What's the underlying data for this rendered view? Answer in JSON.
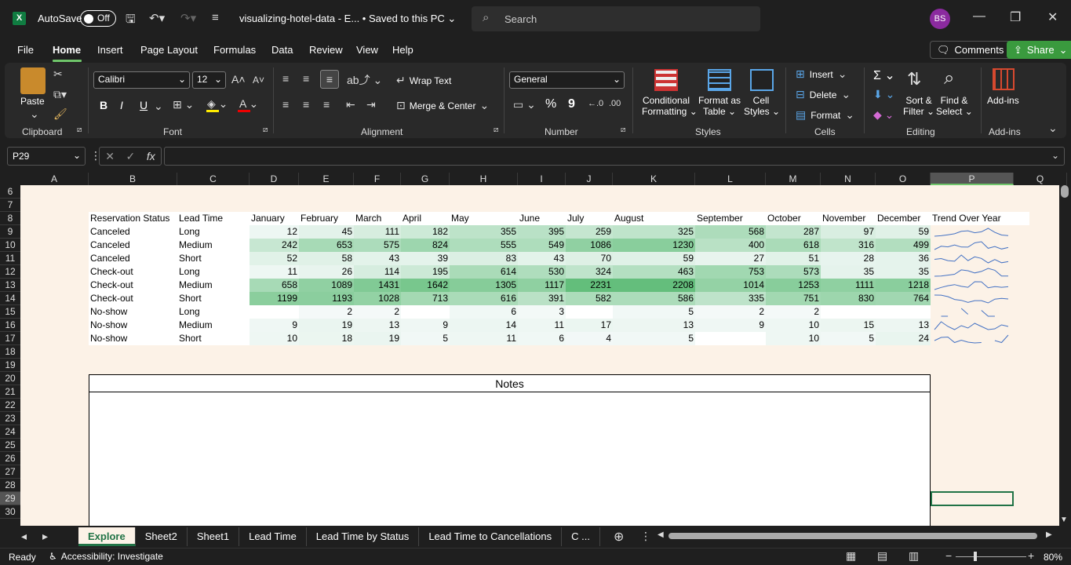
{
  "titlebar": {
    "app_icon": "X",
    "autosave_label": "AutoSave",
    "autosave_state": "Off",
    "filename": "visualizing-hotel-data  -  E...  •  Saved to this PC",
    "search_placeholder": "Search",
    "user_initials": "BS"
  },
  "menu": {
    "tabs": [
      "File",
      "Home",
      "Insert",
      "Page Layout",
      "Formulas",
      "Data",
      "Review",
      "View",
      "Help"
    ],
    "active": "Home",
    "comments": "Comments",
    "share": "Share"
  },
  "ribbon": {
    "clipboard": {
      "label": "Clipboard",
      "paste": "Paste"
    },
    "font": {
      "label": "Font",
      "name": "Calibri",
      "size": "12",
      "bold": "B",
      "italic": "I",
      "underline": "U"
    },
    "alignment": {
      "label": "Alignment",
      "wrap": "Wrap Text",
      "merge": "Merge & Center"
    },
    "number": {
      "label": "Number",
      "format": "General",
      "percent": "%",
      "comma": "9"
    },
    "styles": {
      "label": "Styles",
      "cond1": "Conditional",
      "cond2": "Formatting",
      "fmt1": "Format as",
      "fmt2": "Table",
      "cell1": "Cell",
      "cell2": "Styles"
    },
    "cells": {
      "label": "Cells",
      "insert": "Insert",
      "delete": "Delete",
      "format": "Format"
    },
    "editing": {
      "label": "Editing",
      "sort1": "Sort &",
      "sort2": "Filter",
      "find1": "Find &",
      "find2": "Select",
      "sigma": "Σ"
    },
    "addins": {
      "label": "Add-ins",
      "addins": "Add-ins"
    }
  },
  "formula_bar": {
    "namebox": "P29",
    "fx": "fx",
    "content": ""
  },
  "columns": [
    "A",
    "B",
    "C",
    "D",
    "E",
    "F",
    "G",
    "H",
    "I",
    "J",
    "K",
    "L",
    "M",
    "N",
    "O",
    "P",
    "Q"
  ],
  "selected_column": "P",
  "rows": [
    "6",
    "7",
    "8",
    "9",
    "10",
    "11",
    "12",
    "13",
    "14",
    "15",
    "16",
    "17",
    "18",
    "19",
    "20",
    "21",
    "22",
    "23",
    "24",
    "25",
    "26",
    "27",
    "28",
    "29",
    "30"
  ],
  "selected_row": "29",
  "table": {
    "headers": [
      "Reservation Status",
      "Lead Time",
      "January",
      "February",
      "March",
      "April",
      "May",
      "June",
      "July",
      "August",
      "September",
      "October",
      "November",
      "December",
      "Trend Over Year"
    ],
    "rows": [
      {
        "status": "Canceled",
        "lead": "Long",
        "values": [
          "12",
          "45",
          "111",
          "182",
          "355",
          "395",
          "259",
          "325",
          "568",
          "287",
          "97",
          "59"
        ]
      },
      {
        "status": "Canceled",
        "lead": "Medium",
        "values": [
          "242",
          "653",
          "575",
          "824",
          "555",
          "549",
          "1086",
          "1230",
          "400",
          "618",
          "316",
          "499"
        ]
      },
      {
        "status": "Canceled",
        "lead": "Short",
        "values": [
          "52",
          "58",
          "43",
          "39",
          "83",
          "43",
          "70",
          "59",
          "27",
          "51",
          "28",
          "36"
        ]
      },
      {
        "status": "Check-out",
        "lead": "Long",
        "values": [
          "11",
          "26",
          "114",
          "195",
          "614",
          "530",
          "324",
          "463",
          "753",
          "573",
          "35",
          "35"
        ]
      },
      {
        "status": "Check-out",
        "lead": "Medium",
        "values": [
          "658",
          "1089",
          "1431",
          "1642",
          "1305",
          "1117",
          "2231",
          "2208",
          "1014",
          "1253",
          "1111",
          "1218"
        ]
      },
      {
        "status": "Check-out",
        "lead": "Short",
        "values": [
          "1199",
          "1193",
          "1028",
          "713",
          "616",
          "391",
          "582",
          "586",
          "335",
          "751",
          "830",
          "764"
        ]
      },
      {
        "status": "No-show",
        "lead": "Long",
        "values": [
          "",
          "2",
          "2",
          "",
          "6",
          "3",
          "",
          "5",
          "2",
          "2",
          "",
          ""
        ]
      },
      {
        "status": "No-show",
        "lead": "Medium",
        "values": [
          "9",
          "19",
          "13",
          "9",
          "14",
          "11",
          "17",
          "13",
          "9",
          "10",
          "15",
          "13"
        ]
      },
      {
        "status": "No-show",
        "lead": "Short",
        "values": [
          "10",
          "18",
          "19",
          "5",
          "11",
          "6",
          "4",
          "5",
          "",
          "10",
          "5",
          "24"
        ]
      }
    ]
  },
  "notes_title": "Notes",
  "sheet_tabs": [
    "Explore",
    "Sheet2",
    "Sheet1",
    "Lead Time",
    "Lead Time by Status",
    "Lead Time to Cancellations",
    "C ..."
  ],
  "active_sheet": "Explore",
  "status": {
    "ready": "Ready",
    "accessibility": "Accessibility: Investigate",
    "zoom": "80%"
  },
  "colors": {
    "accent": "#217346",
    "heat_max": "#63be7b",
    "sheet_bg": "#fcf2e7"
  }
}
